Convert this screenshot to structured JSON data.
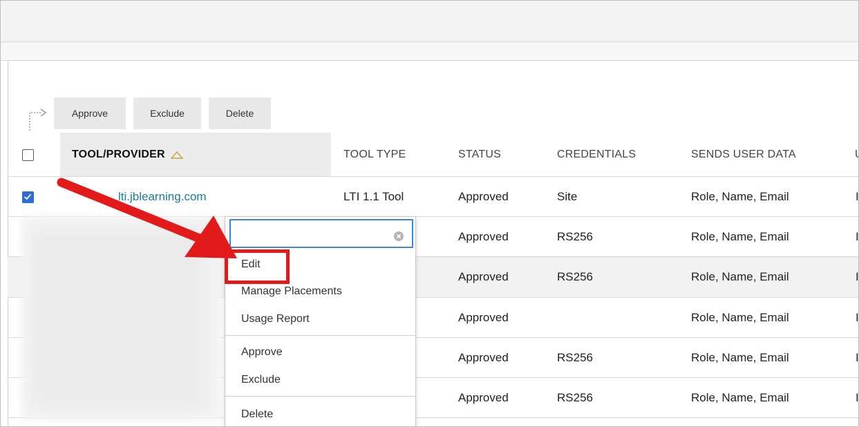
{
  "toolbar": {
    "approve_label": "Approve",
    "exclude_label": "Exclude",
    "delete_label": "Delete"
  },
  "table": {
    "headers": {
      "tool_provider": "TOOL/PROVIDER",
      "tool_type": "TOOL TYPE",
      "status": "STATUS",
      "credentials": "CREDENTIALS",
      "sends_user_data": "SENDS USER DATA",
      "cut_off": "U"
    },
    "rows": [
      {
        "tool": "lti.jblearning.com",
        "type": "LTI 1.1 Tool",
        "status": "Approved",
        "credentials": "Site",
        "sends": "Role, Name, Email",
        "checked": true
      },
      {
        "tool": "",
        "type": "",
        "status": "Approved",
        "credentials": "RS256",
        "sends": "Role, Name, Email",
        "checked": false
      },
      {
        "tool": "",
        "type": "",
        "status": "Approved",
        "credentials": "RS256",
        "sends": "Role, Name, Email",
        "checked": false
      },
      {
        "tool": "",
        "type": "",
        "status": "Approved",
        "credentials": "",
        "sends": "Role, Name, Email",
        "checked": false
      },
      {
        "tool": "",
        "type": "",
        "status": "Approved",
        "credentials": "RS256",
        "sends": "Role, Name, Email",
        "checked": false
      },
      {
        "tool": "",
        "type": "",
        "status": "Approved",
        "credentials": "RS256",
        "sends": "Role, Name, Email",
        "checked": false
      }
    ],
    "cut_off_value": "I"
  },
  "context_menu": {
    "search_value": "",
    "items": {
      "edit": "Edit",
      "manage_placements": "Manage Placements",
      "usage_report": "Usage Report",
      "approve": "Approve",
      "exclude": "Exclude",
      "delete": "Delete"
    }
  },
  "colors": {
    "link": "#1b7c9e",
    "checkbox_checked": "#2f6dd5",
    "annotation_red": "#e21a1a",
    "focus_border": "#3a87d6"
  },
  "icons": {
    "sort": "sort-ascending-triangle-icon",
    "clear": "clear-search-icon",
    "bulk_actions": "bulk-actions-arrow-icon"
  }
}
